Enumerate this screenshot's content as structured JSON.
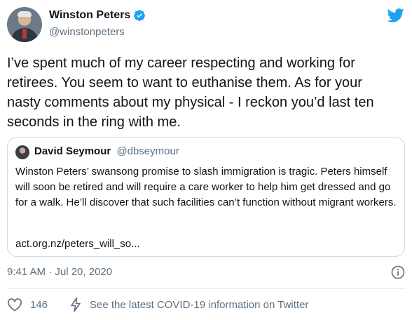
{
  "author": {
    "name": "Winston Peters",
    "handle": "@winstonpeters"
  },
  "tweet": {
    "text": "I’ve spent much of my career respecting and working for\nretirees. You seem to want to euthanise them. As for your\nnasty comments about my physical - I reckon you’d last ten\nseconds in the ring with me.",
    "timestamp": "9:41 AM · Jul 20, 2020",
    "likes": "146"
  },
  "quoted": {
    "name": "David Seymour",
    "handle": "@dbseymour",
    "text": "Winston Peters’ swansong promise to slash immigration is tragic. Peters himself will soon be retired and will require a care worker to help him get dressed and go for a walk. He’ll discover that such facilities can’t function without migrant workers.",
    "link": "act.org.nz/peters_will_so..."
  },
  "footer": {
    "covid_text": "See the latest COVID-19 information on Twitter"
  },
  "colors": {
    "twitter_blue": "#1da1f2",
    "secondary_text": "#5b7083",
    "border": "#cfd9de"
  },
  "icons": [
    "verified-badge-icon",
    "twitter-bird-icon",
    "info-icon",
    "heart-icon",
    "lightning-bolt-icon"
  ]
}
